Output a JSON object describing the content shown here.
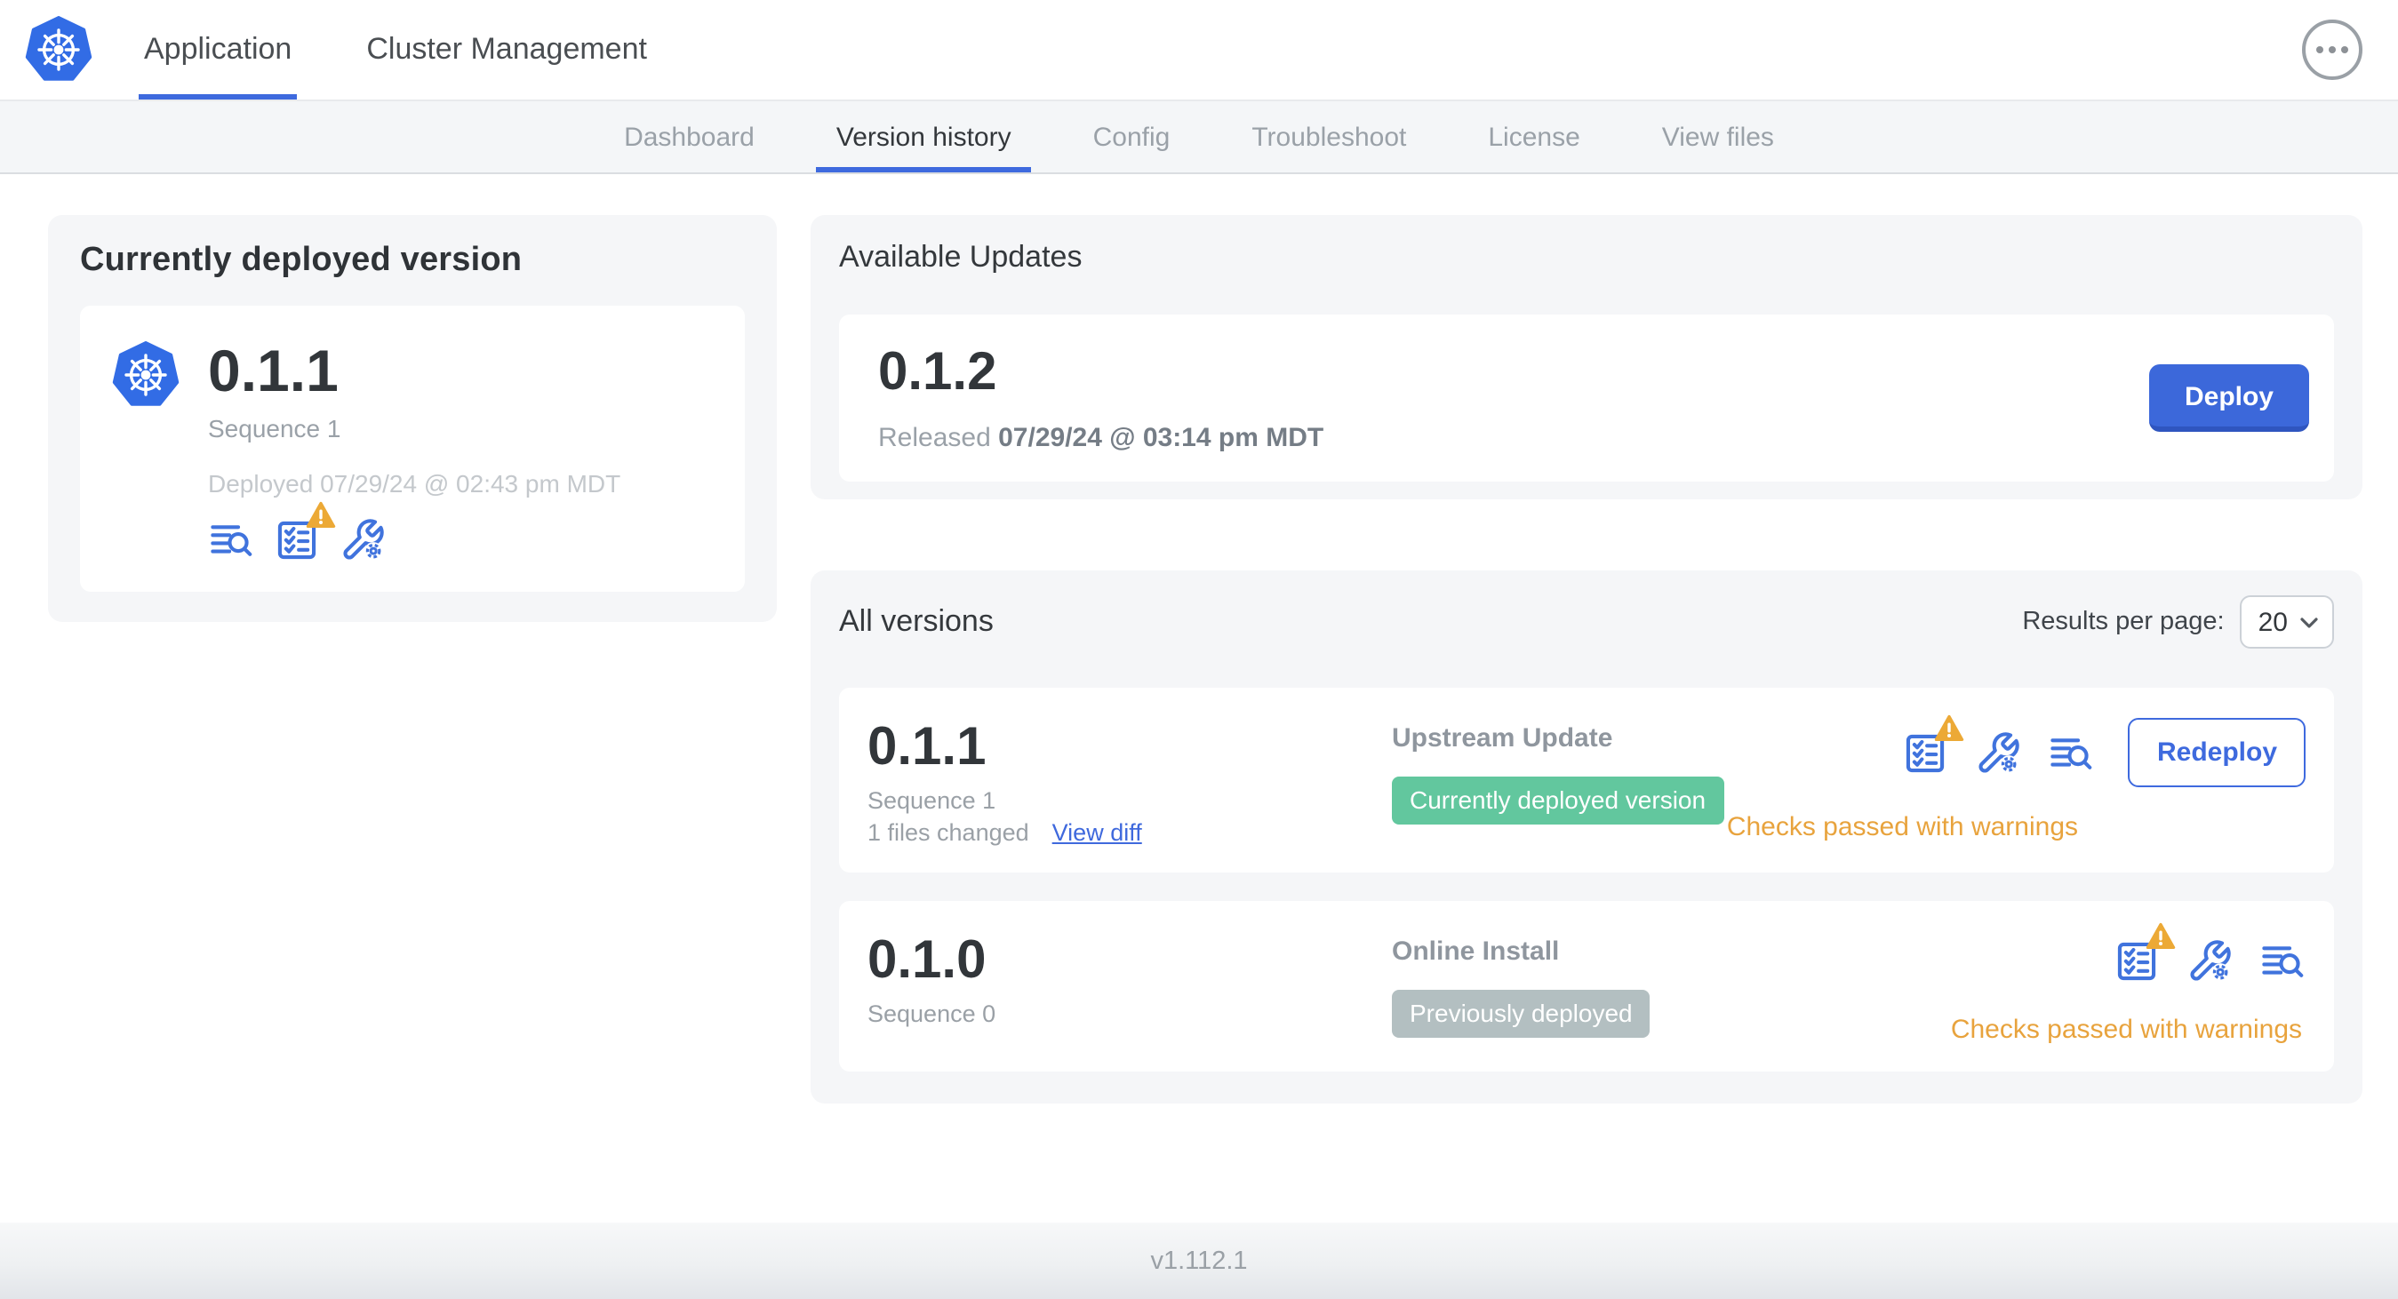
{
  "header": {
    "tabs": [
      {
        "label": "Application",
        "active": true
      },
      {
        "label": "Cluster Management",
        "active": false
      }
    ]
  },
  "subnav": {
    "tabs": [
      "Dashboard",
      "Version history",
      "Config",
      "Troubleshoot",
      "License",
      "View files"
    ],
    "active_tab": "Version history"
  },
  "current_version_card": {
    "title": "Currently deployed version",
    "version": "0.1.1",
    "sequence": "Sequence 1",
    "deployed": "Deployed 07/29/24 @ 02:43 pm MDT"
  },
  "available_updates": {
    "title": "Available Updates",
    "version": "0.1.2",
    "released_prefix": "Released",
    "released_date": "07/29/24 @ 03:14 pm MDT",
    "deploy_label": "Deploy"
  },
  "all_versions": {
    "title": "All versions",
    "results_per_page": {
      "label": "Results per page:",
      "value": "20"
    },
    "rows": [
      {
        "version": "0.1.1",
        "sequence": "Sequence 1",
        "files_changed": "1 files changed",
        "view_diff_label": "View diff",
        "source": "Upstream Update",
        "badge": "Currently deployed version",
        "badge_color": "#62c79e",
        "action_label": "Redeploy",
        "status": "Checks passed with warnings"
      },
      {
        "version": "0.1.0",
        "sequence": "Sequence 0",
        "source": "Online Install",
        "badge": "Previously deployed",
        "badge_color": "#b3bfc1",
        "status": "Checks passed with warnings"
      }
    ]
  },
  "footer": {
    "version": "v1.112.1"
  },
  "colors": {
    "accent_blue": "#3e6ade",
    "kubernetes_blue": "#326ce5",
    "icon_blue": "#4073dd",
    "warning_orange": "#eca936",
    "status_orange": "#e8a33d",
    "green_badge": "#62c79e",
    "gray_badge": "#b3bfc1",
    "panel_gray": "#f5f6f8"
  },
  "icons": {
    "kubernetes_logo": "heptagon-helm-wheel",
    "view_logs": "text-lines-with-magnifier",
    "preflight_checks": "checklist-clipboard",
    "configure": "wrench-with-gear",
    "warning": "triangle-exclamation",
    "overflow_menu": "ellipsis-in-circle",
    "select_chevron": "chevron-down"
  }
}
